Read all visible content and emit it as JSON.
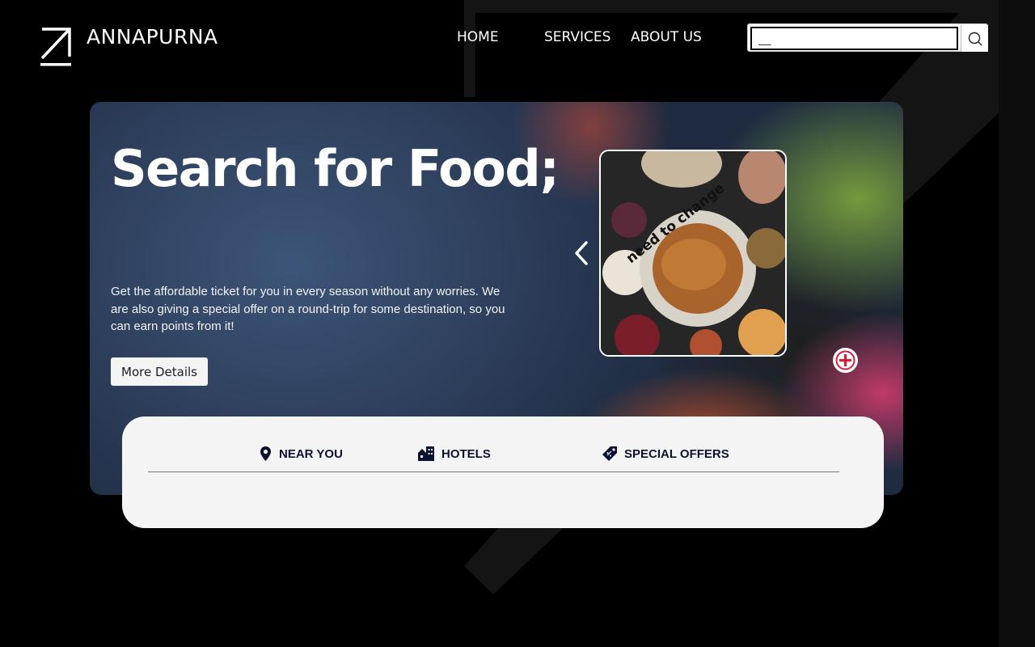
{
  "header": {
    "brand": "ANNAPURNA",
    "nav": {
      "home": "HOME",
      "services": "SERVICES",
      "about": "ABOUT US"
    },
    "search": {
      "value": "__",
      "icon": "search-icon"
    },
    "logo_icon": "arrow-up-right-icon"
  },
  "hero": {
    "title": "Search for Food;",
    "description": "Get the affordable ticket for you in every season without any worries. We are also giving a special offer on a round-trip for some destination, so you can earn points from it!",
    "button_label": "More Details",
    "card_note": "need to change",
    "prev_icon": "chevron-left-icon",
    "add_icon": "plus-circle-icon"
  },
  "panel": {
    "tabs": [
      {
        "label": "NEAR YOU",
        "icon": "location-pin-icon"
      },
      {
        "label": "HOTELS",
        "icon": "hotel-building-icon"
      },
      {
        "label": "SPECIAL OFFERS",
        "icon": "tag-icon"
      }
    ]
  },
  "colors": {
    "background": "#000000",
    "panel": "#f4f4f4",
    "tab_text": "#0b1230",
    "accent_red": "#d0213a"
  }
}
